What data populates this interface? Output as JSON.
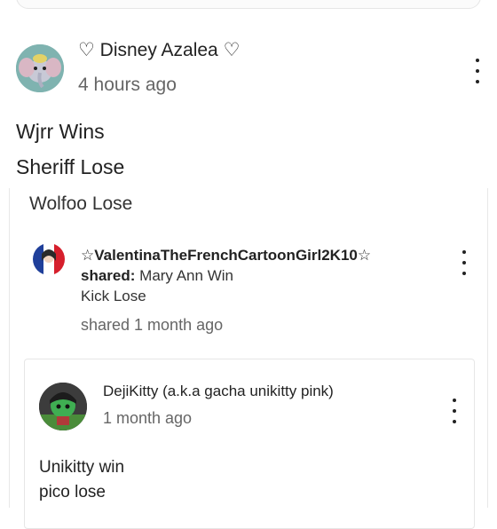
{
  "previous_card": {},
  "post": {
    "author": "♡ Disney Azalea ♡",
    "timestamp": "4 hours ago",
    "lines": [
      "Wjrr Wins",
      "Sheriff Lose"
    ]
  },
  "shared_post": {
    "text": "Wolfoo Lose",
    "sharer": "☆ValentinaTheFrenchCartoonGirl2K10☆",
    "shared_label": "shared:",
    "shared_lines": [
      "Mary Ann Win",
      "Kick Lose"
    ],
    "shared_time": "shared 1 month ago"
  },
  "inner_post": {
    "author": "DejiKitty (a.k.a gacha unikitty pink)",
    "timestamp": "1 month ago",
    "lines": [
      "Unikitty win",
      "pico lose"
    ]
  },
  "icons": {
    "avatar": "dumbo-elephant-avatar",
    "sharer_avatar": "french-flag-avatar",
    "inner_avatar": "green-character-avatar",
    "menu": "more-vertical-icon"
  }
}
